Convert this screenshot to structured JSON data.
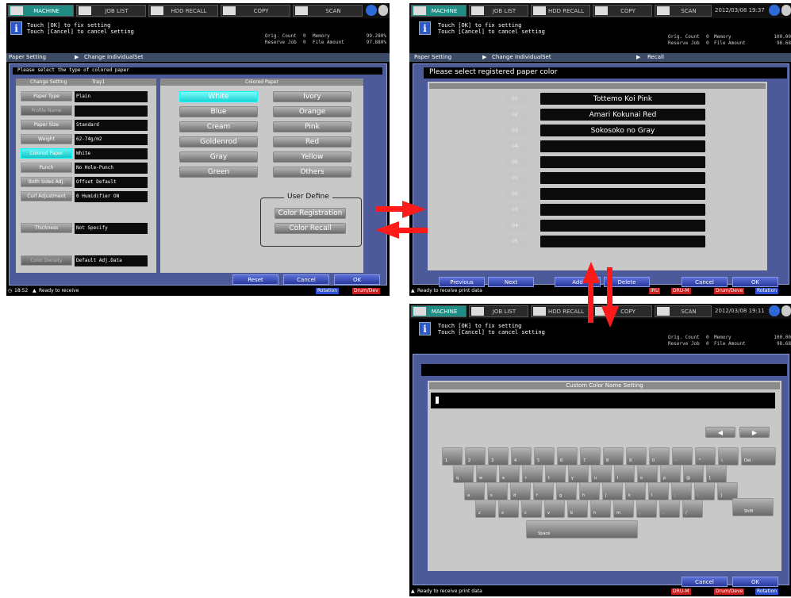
{
  "colors": {
    "accent": "#1f8d84",
    "frame": "#4c5a9a",
    "cyan_selected": "#2ae0e0",
    "arrow": "#ff1a1a"
  },
  "header_tabs": {
    "machine": "MACHINE",
    "job_list": "JOB LIST",
    "hdd_recall": "HDD RECALL",
    "copy": "COPY",
    "scan": "SCAN"
  },
  "message": {
    "line1": "Touch [OK] to fix setting",
    "line2": "Touch [Cancel] to cancel setting"
  },
  "left": {
    "counters": {
      "orig_count_label": "Orig. Count",
      "orig_count": "0",
      "memory_label": "Memory",
      "memory": "99.280%",
      "reserve_label": "Reserve Job",
      "reserve": "0",
      "file_label": "File Amount",
      "file": "97.880%"
    },
    "breadcrumb": {
      "paper_setting": "Paper Setting",
      "change_individual": "Change IndividualSet"
    },
    "instruction": "Please select the type of colored paper",
    "change_setting_header": "Change Setting",
    "tray_label": "Tray1",
    "colored_paper_header": "Colored Paper",
    "settings": [
      {
        "label": "Paper Type",
        "value": "Plain"
      },
      {
        "label": "Profile Name",
        "value": ""
      },
      {
        "label": "Paper Size",
        "value": "Standard"
      },
      {
        "label": "Weight",
        "value": "62-74g/m2"
      },
      {
        "label": "Colored Paper",
        "value": "White"
      },
      {
        "label": "Punch",
        "value": "No Hole-Punch"
      },
      {
        "label": "Both Sides Adj.",
        "value": "Offset Default"
      },
      {
        "label": "Curl Adjustment",
        "value": "0  Humidifier ON"
      },
      {
        "label": "Thickness",
        "value": "Not Specify"
      },
      {
        "label": "Color Density",
        "value": "Default Adj.Data"
      }
    ],
    "colors_list": [
      "White",
      "Ivory",
      "Blue",
      "Orange",
      "Cream",
      "Pink",
      "Goldenrod",
      "Red",
      "Gray",
      "Yellow",
      "Green",
      "Others"
    ],
    "user_define": {
      "title": "User Define",
      "registration": "Color Registration",
      "recall": "Color Recall"
    },
    "footer": {
      "reset": "Reset",
      "cancel": "Cancel",
      "ok": "OK"
    },
    "status": {
      "time": "18:52",
      "text": "Ready to receive",
      "rotation": "Rotation",
      "drum": "Drum/Dev"
    }
  },
  "right_top": {
    "datetime": "2012/03/08  19:37",
    "counters": {
      "orig_count_label": "Orig. Count",
      "orig_count": "0",
      "memory_label": "Memory",
      "memory": "100.00",
      "reserve_label": "Reserve Job",
      "reserve": "0",
      "file_label": "File Amount",
      "file": "98.68"
    },
    "breadcrumb": {
      "paper_setting": "Paper Setting",
      "change_individual": "Change IndividualSet",
      "recall": "Recall"
    },
    "instruction": "Please select registered paper color",
    "entries": [
      {
        "num": "01",
        "name": "Tottemo Koi Pink"
      },
      {
        "num": "02",
        "name": "Amari Kokunai Red"
      },
      {
        "num": "03",
        "name": "Sokosoko no Gray"
      },
      {
        "num": "04",
        "name": ""
      },
      {
        "num": "05",
        "name": ""
      },
      {
        "num": "01",
        "name": ""
      },
      {
        "num": "02",
        "name": ""
      },
      {
        "num": "03",
        "name": ""
      },
      {
        "num": "04",
        "name": ""
      },
      {
        "num": "05",
        "name": ""
      }
    ],
    "footer": {
      "previous": "Previous",
      "next": "Next",
      "add": "Add",
      "delete": "Delete",
      "cancel": "Cancel",
      "ok": "OK"
    },
    "status": {
      "text": "Ready to receive print data",
      "iru": "IRU",
      "dru": "DRU-M",
      "drum": "Drum/Deve",
      "rotation": "Rotation"
    }
  },
  "right_bottom": {
    "datetime": "2012/03/08  19:11",
    "counters": {
      "orig_count_label": "Orig. Count",
      "orig_count": "0",
      "memory_label": "Memory",
      "memory": "100.00",
      "reserve_label": "Reserve Job",
      "reserve": "0",
      "file_label": "File Amount",
      "file": "98.68"
    },
    "dialog_title": "Custom Color Name Setting",
    "input_value": "",
    "keys_row1": [
      "1",
      "2",
      "3",
      "4",
      "5",
      "6",
      "7",
      "8",
      "9",
      "0",
      "-",
      "^",
      "\\",
      "Del"
    ],
    "keys_row2": [
      "q",
      "w",
      "e",
      "r",
      "t",
      "y",
      "u",
      "i",
      "o",
      "p",
      "@",
      "["
    ],
    "keys_row3": [
      "a",
      "s",
      "d",
      "f",
      "g",
      "h",
      "j",
      "k",
      "l",
      ";",
      ":",
      "]"
    ],
    "keys_row4": [
      "z",
      "x",
      "c",
      "v",
      "b",
      "n",
      "m",
      ",",
      ".",
      "/"
    ],
    "shift": "Shift",
    "space": "Space",
    "footer": {
      "cancel": "Cancel",
      "ok": "OK"
    },
    "status": {
      "text": "Ready to receive print data",
      "dru": "DRU-M",
      "drum": "Drum/Deve",
      "rotation": "Rotation"
    }
  }
}
